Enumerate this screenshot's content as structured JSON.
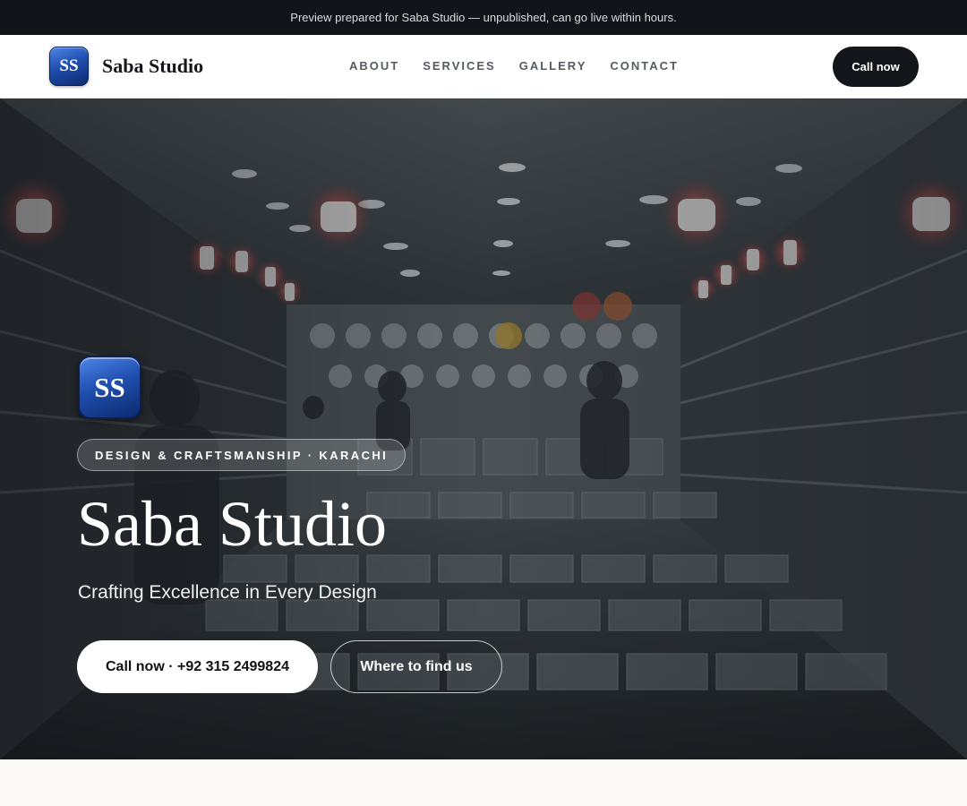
{
  "preview_banner": {
    "text": "Preview prepared for Saba Studio — unpublished, can go live within hours."
  },
  "header": {
    "logo_initials": "SS",
    "brand_name": "Saba Studio",
    "nav": [
      "ABOUT",
      "SERVICES",
      "GALLERY",
      "CONTACT"
    ],
    "call_button": "Call now"
  },
  "hero": {
    "logo_initials": "SS",
    "tagline": "DESIGN & CRAFTSMANSHIP · KARACHI",
    "title": "Saba Studio",
    "subtitle": "Crafting Excellence in Every Design",
    "primary_button": "Call now · +92 315 2499824",
    "secondary_button": "Where to find us"
  },
  "colors": {
    "banner_bg": "#111418",
    "logo_blue": "#1f4fb0",
    "call_button_bg": "#14161b",
    "page_bg": "#faf9f6"
  }
}
